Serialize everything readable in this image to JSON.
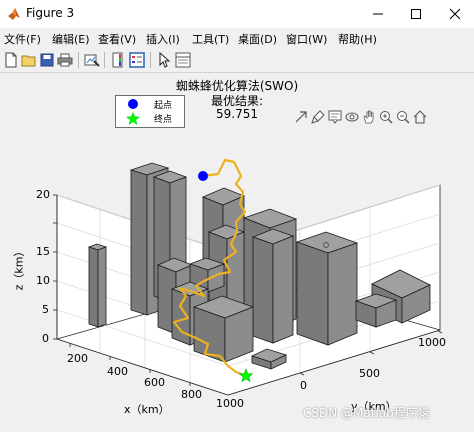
{
  "window": {
    "title": "Figure 3"
  },
  "menu": [
    "文件(F)",
    "编辑(E)",
    "查看(V)",
    "插入(I)",
    "工具(T)",
    "桌面(D)",
    "窗口(W)",
    "帮助(H)"
  ],
  "toolbar": [
    "new-file",
    "open-file",
    "save",
    "print",
    "link-plot",
    "toggle-colorbar",
    "insert-legend",
    "edit-plot",
    "property-inspector"
  ],
  "axes_toolbar": [
    "export",
    "brush",
    "data-tips",
    "rotate-3d",
    "pan",
    "zoom-in",
    "zoom-out",
    "home"
  ],
  "plot": {
    "title": "蜘蛛蜂优化算法(SWO)",
    "subtitle": "最优结果:",
    "value": "59.751",
    "legend": [
      {
        "label": "起点",
        "marker": "circle",
        "color": "#0000ff"
      },
      {
        "label": "终点",
        "marker": "star",
        "color": "#00ff00"
      }
    ],
    "xlabel": "x（km）",
    "ylabel": "y（km）",
    "zlabel": "z（km）",
    "xticks": [
      "200",
      "400",
      "600",
      "800",
      "1000"
    ],
    "yticks": [
      "0",
      "500",
      "1000"
    ],
    "zticks": [
      "0",
      "5",
      "10",
      "15",
      "20"
    ],
    "colors": {
      "buildings": "#808080",
      "path": "#edb120",
      "start": "#0000ff",
      "end": "#00ff00"
    }
  },
  "watermark": "CSDN @Matlab程序猿"
}
